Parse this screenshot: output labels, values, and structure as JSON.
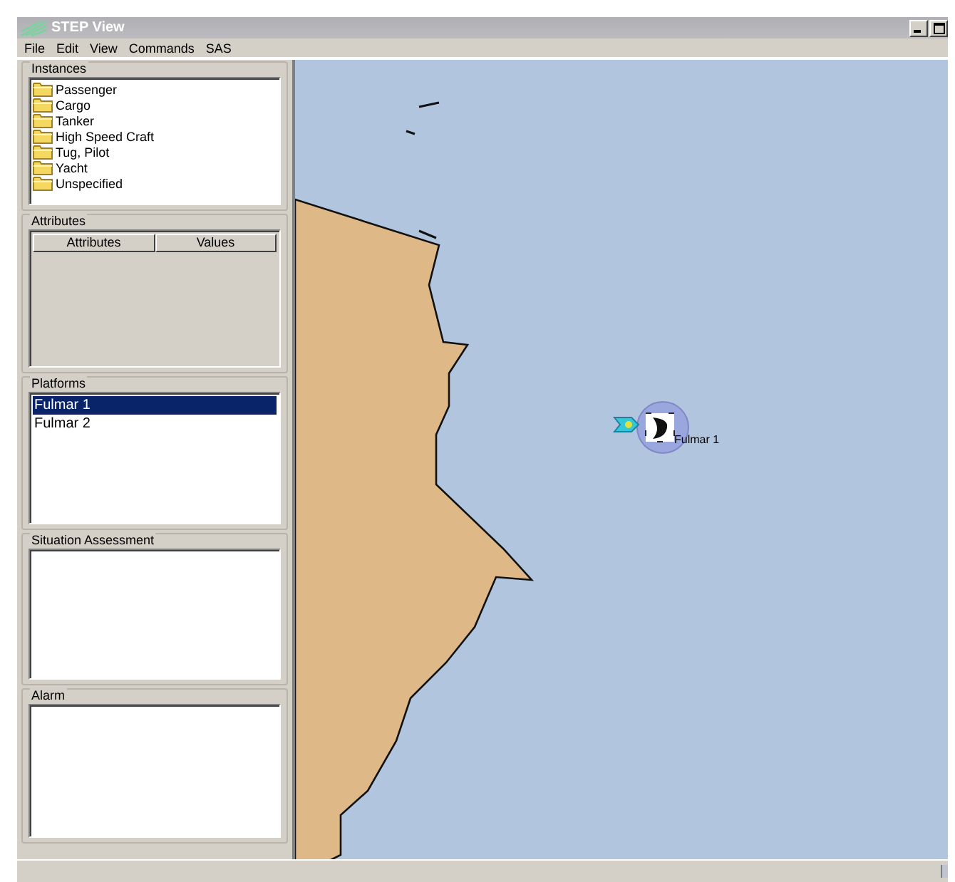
{
  "window": {
    "title": "STEP View"
  },
  "menu": [
    "File",
    "Edit",
    "View",
    "Commands",
    "SAS"
  ],
  "instances": {
    "title": "Instances",
    "items": [
      {
        "label": "Passenger"
      },
      {
        "label": "Cargo"
      },
      {
        "label": "Tanker"
      },
      {
        "label": "High Speed Craft"
      },
      {
        "label": "Tug, Pilot"
      },
      {
        "label": "Yacht"
      },
      {
        "label": "Unspecified"
      }
    ]
  },
  "attributes": {
    "title": "Attributes",
    "columns": [
      "Attributes",
      "Values"
    ]
  },
  "platforms": {
    "title": "Platforms",
    "items": [
      {
        "label": "Fulmar 1",
        "selected": true
      },
      {
        "label": "Fulmar 2",
        "selected": false
      }
    ]
  },
  "situation_assessment": {
    "title": "Situation Assessment"
  },
  "alarm": {
    "title": "Alarm"
  },
  "map": {
    "markers": [
      {
        "label": "Fulmar 1"
      }
    ]
  }
}
